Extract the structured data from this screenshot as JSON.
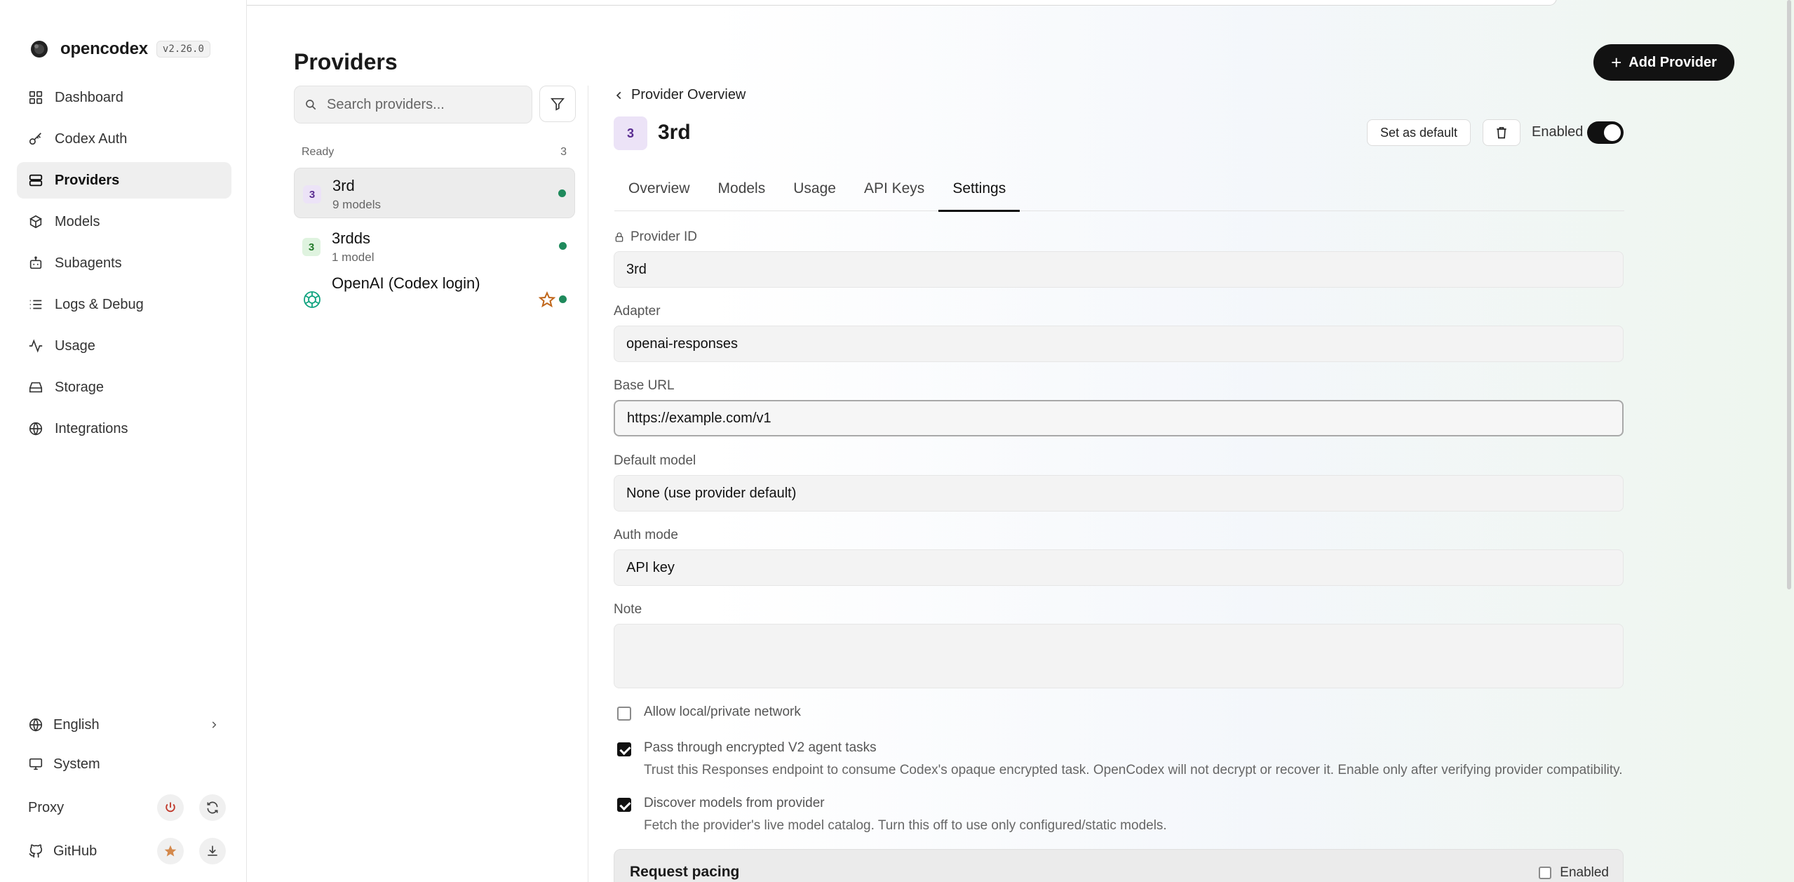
{
  "app": {
    "name": "opencodex",
    "version": "v2.26.0"
  },
  "sidebar": {
    "items": [
      {
        "label": "Dashboard",
        "icon": "dashboard-icon"
      },
      {
        "label": "Codex Auth",
        "icon": "key-icon"
      },
      {
        "label": "Providers",
        "icon": "server-icon",
        "active": true
      },
      {
        "label": "Models",
        "icon": "cube-icon"
      },
      {
        "label": "Subagents",
        "icon": "bot-icon"
      },
      {
        "label": "Logs & Debug",
        "icon": "list-icon"
      },
      {
        "label": "Usage",
        "icon": "activity-icon"
      },
      {
        "label": "Storage",
        "icon": "storage-icon"
      },
      {
        "label": "Integrations",
        "icon": "globe-icon"
      }
    ],
    "language": "English",
    "theme": "System",
    "proxy": "Proxy",
    "github": "GitHub"
  },
  "providers_page": {
    "title": "Providers",
    "search_placeholder": "Search providers...",
    "group_label": "Ready",
    "group_count": "3",
    "list": [
      {
        "badge": "3",
        "name": "3rd",
        "sub": "9 models"
      },
      {
        "badge": "3",
        "name": "3rdds",
        "sub": "1 model"
      },
      {
        "name": "OpenAI (Codex login)",
        "sub": ""
      }
    ]
  },
  "detail": {
    "add_button": "Add Provider",
    "back_label": "Provider Overview",
    "badge": "3",
    "title": "3rd",
    "set_default": "Set as default",
    "enabled_label": "Enabled",
    "enabled": true,
    "tabs": [
      "Overview",
      "Models",
      "Usage",
      "API Keys",
      "Settings"
    ],
    "active_tab": "Settings",
    "fields": {
      "provider_id_label": "Provider ID",
      "provider_id": "3rd",
      "adapter_label": "Adapter",
      "adapter": "openai-responses",
      "base_url_label": "Base URL",
      "base_url": "https://example.com/v1",
      "default_model_label": "Default model",
      "default_model": "None (use provider default)",
      "auth_mode_label": "Auth mode",
      "auth_mode": "API key",
      "note_label": "Note",
      "note": ""
    },
    "checks": [
      {
        "title": "Allow local/private network",
        "desc": "",
        "checked": false
      },
      {
        "title": "Pass through encrypted V2 agent tasks",
        "desc": "Trust this Responses endpoint to consume Codex's opaque encrypted task. OpenCodex will not decrypt or recover it. Enable only after verifying provider compatibility.",
        "checked": true
      },
      {
        "title": "Discover models from provider",
        "desc": "Fetch the provider's live model catalog. Turn this off to use only configured/static models.",
        "checked": true
      }
    ],
    "pacing": {
      "title": "Request pacing",
      "enabled_label": "Enabled",
      "enabled": false
    }
  },
  "colors": {
    "accent": "#111111",
    "status_ready": "#1f8a5c",
    "badge_purple_bg": "#ece3f7",
    "badge_green_bg": "#dff3df",
    "star": "#c0661a"
  }
}
